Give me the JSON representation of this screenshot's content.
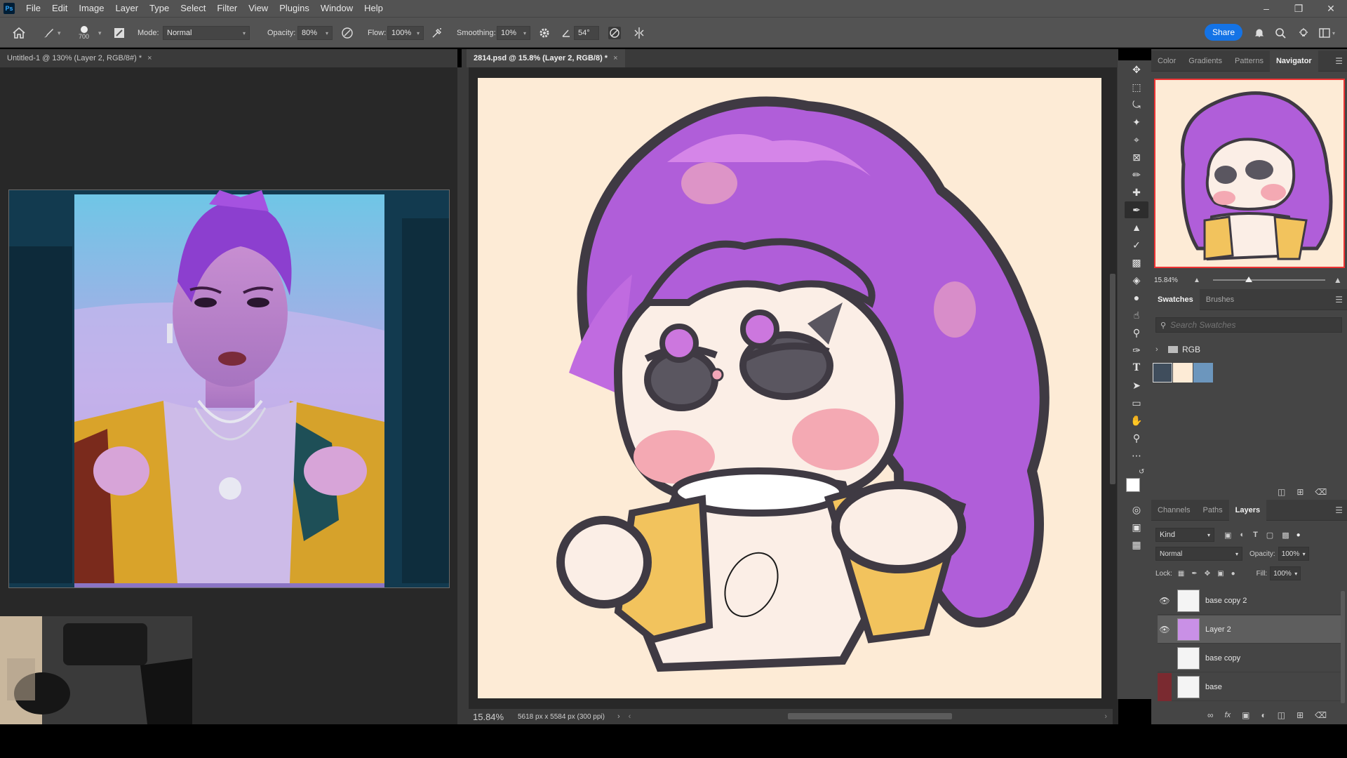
{
  "menubar": {
    "logo": "Ps",
    "items": [
      "File",
      "Edit",
      "Image",
      "Layer",
      "Type",
      "Select",
      "Filter",
      "View",
      "Plugins",
      "Window",
      "Help"
    ]
  },
  "options": {
    "brush_size": "700",
    "mode_label": "Mode:",
    "mode_value": "Normal",
    "opacity_label": "Opacity:",
    "opacity_value": "80%",
    "flow_label": "Flow:",
    "flow_value": "100%",
    "smoothing_label": "Smoothing:",
    "smoothing_value": "10%",
    "angle_value": "54°",
    "share_label": "Share"
  },
  "documents": {
    "left_tab": "Untitled-1 @ 130% (Layer 2, RGB/8#) *",
    "right_tab": "2814.psd @ 15.8% (Layer 2, RGB/8) *"
  },
  "status": {
    "zoom": "15.84%",
    "doc_info": "5618 px x 5584 px (300 ppi)"
  },
  "panels": {
    "top_tabs": [
      "Color",
      "Gradients",
      "Patterns",
      "Navigator"
    ],
    "navigator_zoom": "15.84%",
    "mid_tabs": [
      "Swatches",
      "Brushes"
    ],
    "search_placeholder": "Search Swatches",
    "swatch_group": "RGB",
    "swatch_colors": [
      "#3f4d5c",
      "#fdebd6",
      "#6c96bd"
    ],
    "bottom_tabs": [
      "Channels",
      "Paths",
      "Layers"
    ],
    "layers": {
      "kind_label": "Kind",
      "blend_mode": "Normal",
      "opacity_label": "Opacity:",
      "opacity_value": "100%",
      "lock_label": "Lock:",
      "fill_label": "Fill:",
      "fill_value": "100%",
      "items": [
        {
          "name": "base copy 2",
          "visible": true,
          "selected": false
        },
        {
          "name": "Layer 2",
          "visible": true,
          "selected": true
        },
        {
          "name": "base copy",
          "visible": false,
          "selected": false
        },
        {
          "name": "base",
          "visible": false,
          "selected": false
        }
      ]
    }
  },
  "colors": {
    "accent": "#1473e6",
    "ui_bg": "#535353",
    "canvas_bg": "#fdebd6"
  }
}
